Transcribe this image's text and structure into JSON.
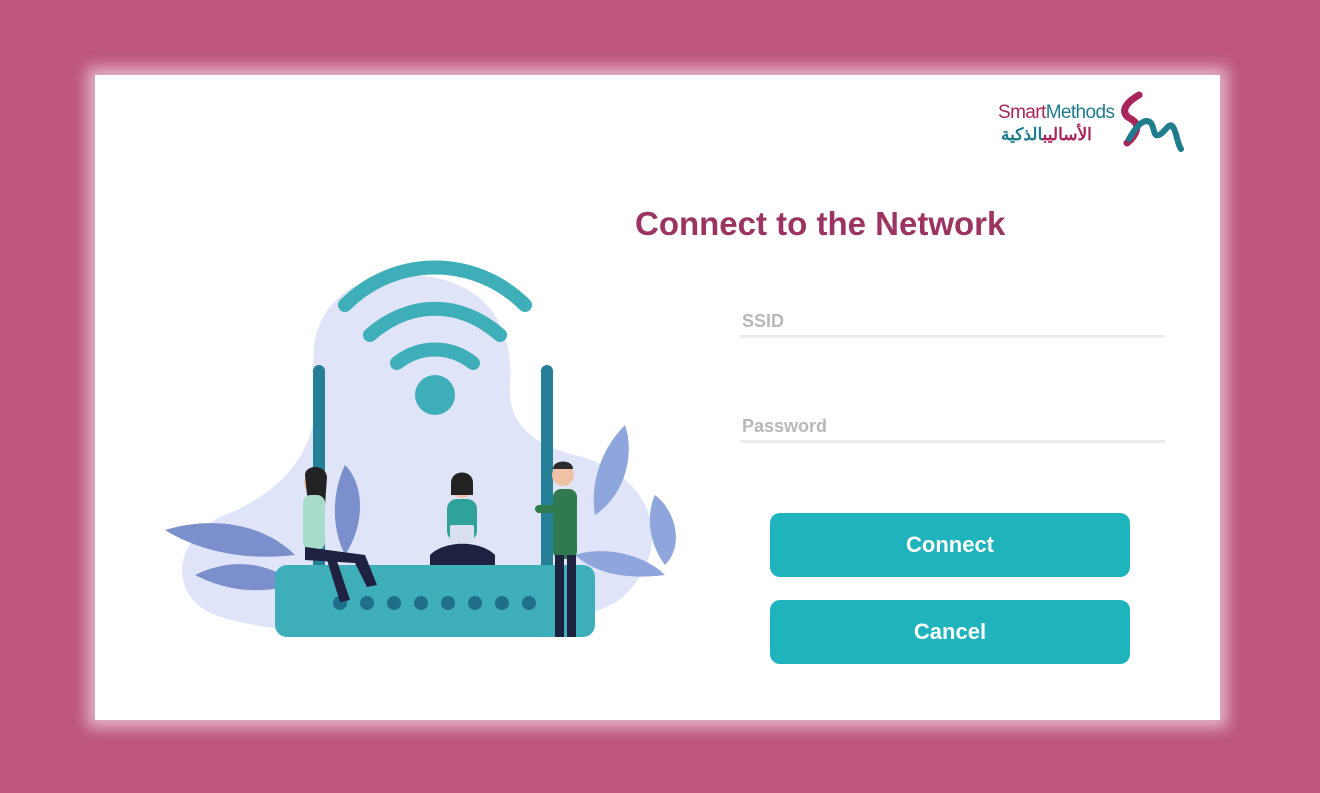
{
  "logo": {
    "word1": "Smart",
    "word2": "Methods",
    "arabic_part1": "الأساليب",
    "arabic_part2": "الذكية"
  },
  "page": {
    "title": "Connect to the Network"
  },
  "form": {
    "ssid_placeholder": "SSID",
    "ssid_value": "",
    "password_placeholder": "Password",
    "password_value": ""
  },
  "buttons": {
    "connect_label": "Connect",
    "cancel_label": "Cancel"
  },
  "colors": {
    "background": "#bd557d",
    "card": "#ffffff",
    "title": "#9c3462",
    "button": "#1fb3bd",
    "illustration_teal": "#3eafb8",
    "illustration_blob": "#dfe4f8",
    "illustration_leaf": "#7b8fcc"
  },
  "icons": {
    "logo_mark": "sm-logo-icon",
    "wifi": "wifi-signal-icon",
    "router": "router-icon"
  }
}
